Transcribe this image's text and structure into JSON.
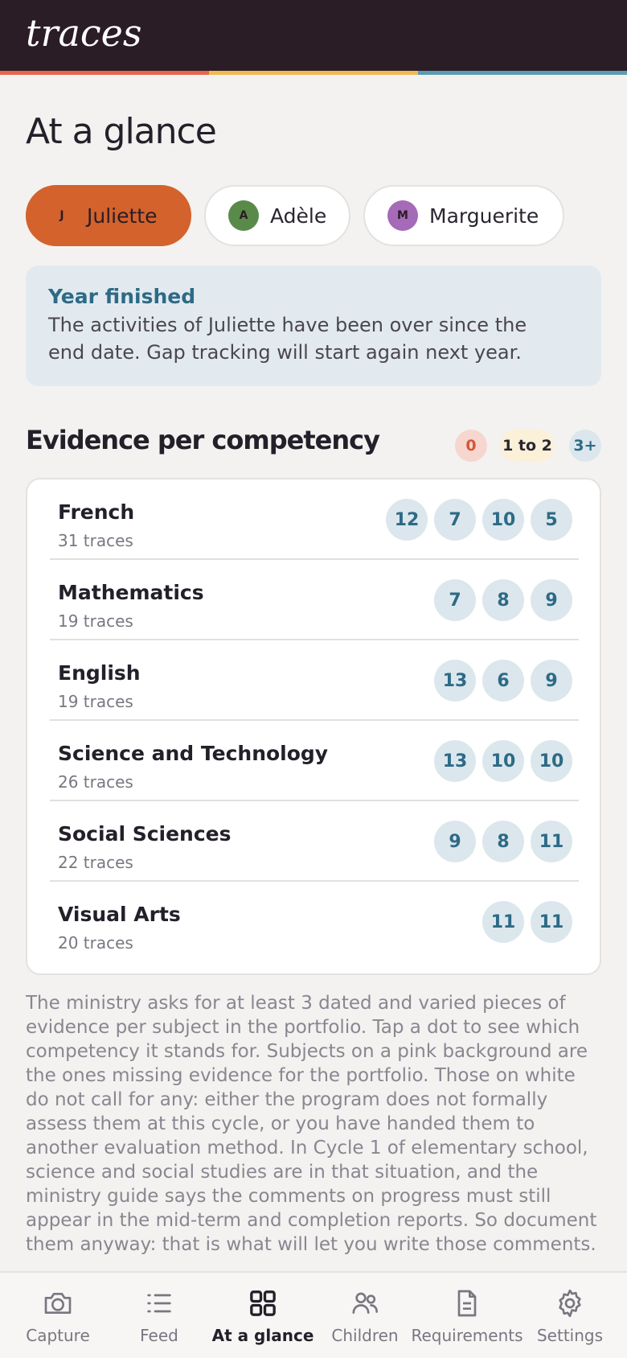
{
  "app": {
    "logo": "traces"
  },
  "colors": {
    "header_bg": "#2a1d25",
    "accent": "#d4622c",
    "stripe": [
      "#e8654c",
      "#f2b94f",
      "#5b9bb3"
    ]
  },
  "page": {
    "title": "At a glance"
  },
  "children": [
    {
      "initial": "J",
      "name": "Juliette",
      "active": true,
      "color": "#d4622c"
    },
    {
      "initial": "A",
      "name": "Adèle",
      "active": false,
      "color": "#5a8a4a"
    },
    {
      "initial": "M",
      "name": "Marguerite",
      "active": false,
      "color": "#a56ab8"
    }
  ],
  "notice": {
    "title": "Year finished",
    "line1": "The activities of Juliette have been over since the",
    "line2": "end date. Gap tracking will start again next year."
  },
  "evidence": {
    "title": "Evidence per competency",
    "legend": {
      "zero": "0",
      "few": "1 to 2",
      "many": "3+"
    },
    "subjects": [
      {
        "name": "French",
        "count": "31 traces",
        "dots": [
          "12",
          "7",
          "10",
          "5"
        ]
      },
      {
        "name": "Mathematics",
        "count": "19 traces",
        "dots": [
          "7",
          "8",
          "9"
        ]
      },
      {
        "name": "English",
        "count": "19 traces",
        "dots": [
          "13",
          "6",
          "9"
        ]
      },
      {
        "name": "Science and Technology",
        "count": "26 traces",
        "dots": [
          "13",
          "10",
          "10"
        ]
      },
      {
        "name": "Social Sciences",
        "count": "22 traces",
        "dots": [
          "9",
          "8",
          "11"
        ]
      },
      {
        "name": "Visual Arts",
        "count": "20 traces",
        "dots": [
          "11",
          "11"
        ]
      }
    ]
  },
  "footnote": "The ministry asks for at least 3 dated and varied pieces of evidence per subject in the portfolio. Tap a dot to see which competency it stands for. Subjects on a pink background are the ones missing evidence for the portfolio. Those on white do not call for any: either the program does not formally assess them at this cycle, or you have handed them to another evaluation method. In Cycle 1 of elementary school, science and social studies are in that situation, and the ministry guide says the comments on progress must still appear in the mid-term and completion reports. So document them anyway: that is what will let you write those comments.",
  "nav": {
    "capture": "Capture",
    "feed": "Feed",
    "glance": "At a glance",
    "children": "Children",
    "requirements": "Requirements",
    "settings": "Settings"
  }
}
